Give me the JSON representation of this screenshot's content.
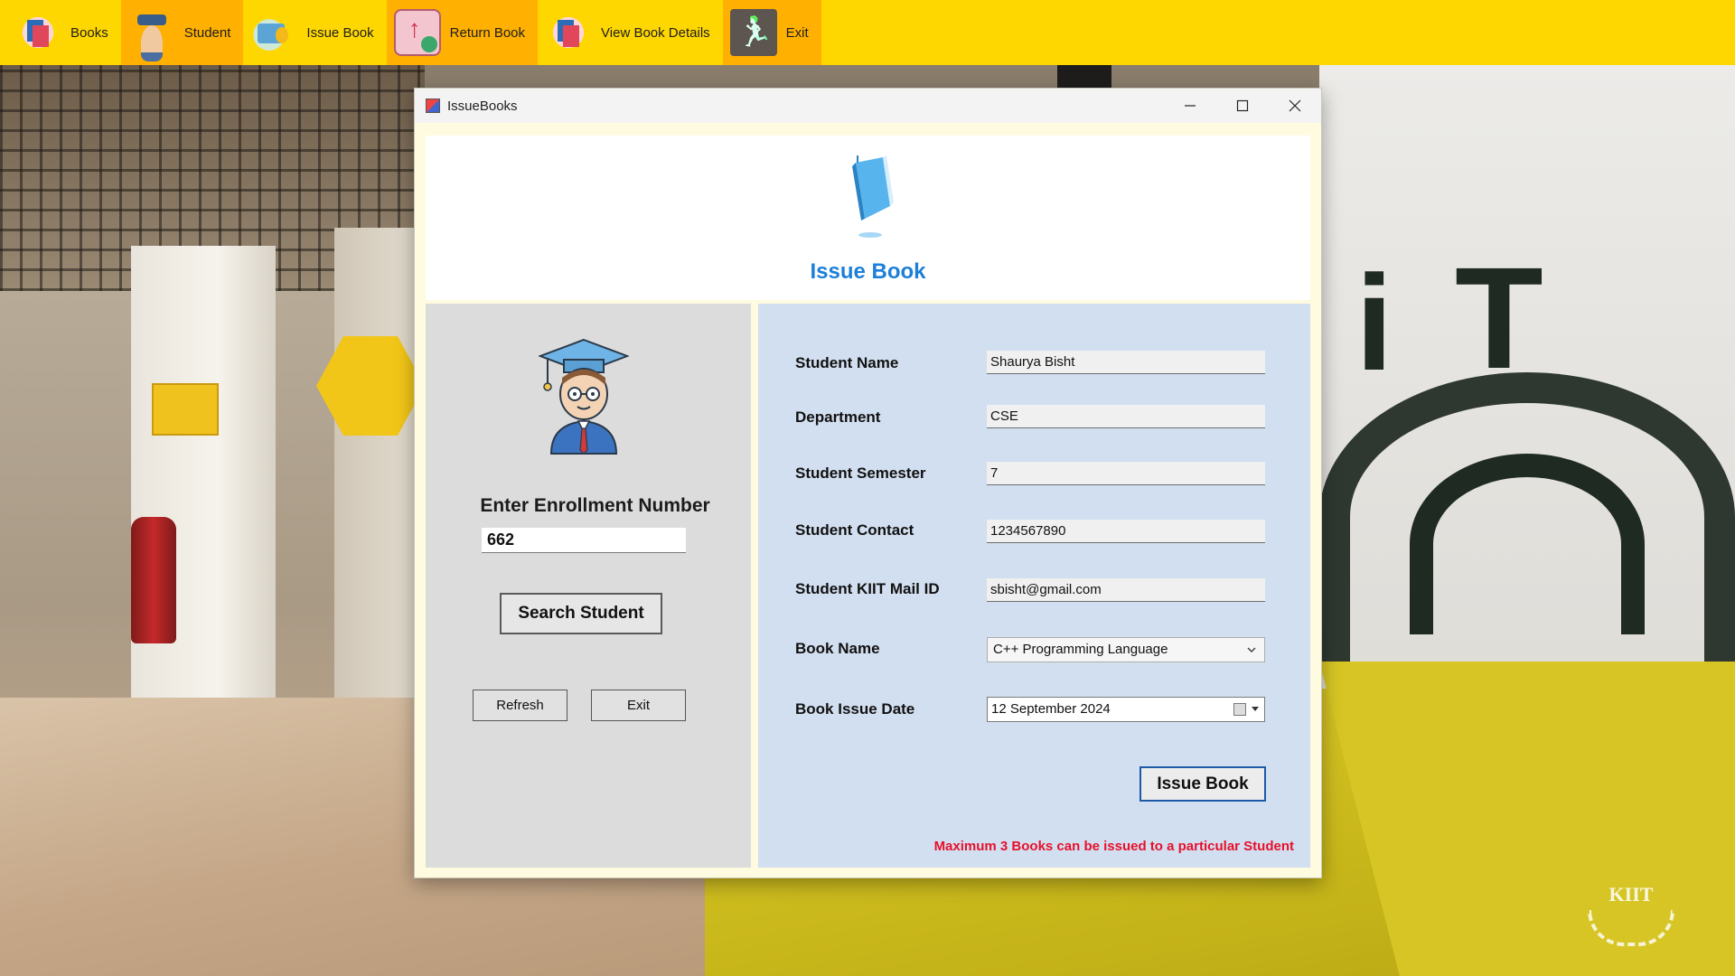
{
  "toolbar": {
    "items": [
      {
        "label": "Books",
        "icon": "books-icon"
      },
      {
        "label": "Student",
        "icon": "student-icon",
        "highlighted": true
      },
      {
        "label": "Issue Book",
        "icon": "issue-book-icon"
      },
      {
        "label": "Return Book",
        "icon": "return-book-icon",
        "highlighted": true
      },
      {
        "label": "View Book Details",
        "icon": "view-book-details-icon"
      },
      {
        "label": "Exit",
        "icon": "exit-runner-icon",
        "highlighted": true
      }
    ],
    "background_color": "#ffd700",
    "highlight_color": "#ffb000"
  },
  "window": {
    "title": "IssueBooks",
    "header_title": "Issue Book",
    "accent_color": "#1c7fd9"
  },
  "left": {
    "enroll_label": "Enter Enrollment Number",
    "enroll_value": "662",
    "search_button": "Search Student",
    "refresh_button": "Refresh",
    "exit_button": "Exit"
  },
  "form": {
    "student_name_label": "Student Name",
    "student_name_value": "Shaurya Bisht",
    "department_label": "Department",
    "department_value": "CSE",
    "semester_label": "Student Semester",
    "semester_value": "7",
    "contact_label": "Student Contact",
    "contact_value": "1234567890",
    "mail_label": "Student KIIT Mail ID",
    "mail_value": "sbisht@gmail.com",
    "book_name_label": "Book Name",
    "book_name_value": "C++ Programming Language",
    "issue_date_label": "Book Issue Date",
    "issue_date_value": "12 September 2024",
    "issue_button": "Issue Book",
    "note": "Maximum 3 Books can be issued to a particular Student",
    "note_color": "#e8102a"
  },
  "background": {
    "logo_text": "KIIT"
  }
}
